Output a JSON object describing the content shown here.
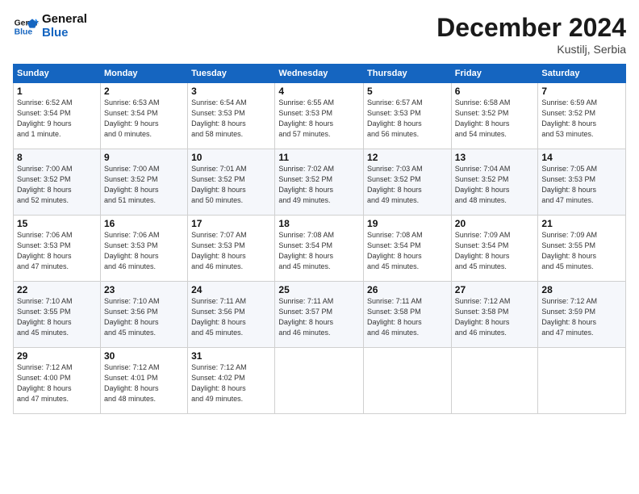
{
  "logo": {
    "line1": "General",
    "line2": "Blue"
  },
  "title": "December 2024",
  "subtitle": "Kustilj, Serbia",
  "header_days": [
    "Sunday",
    "Monday",
    "Tuesday",
    "Wednesday",
    "Thursday",
    "Friday",
    "Saturday"
  ],
  "weeks": [
    [
      {
        "day": "1",
        "info": "Sunrise: 6:52 AM\nSunset: 3:54 PM\nDaylight: 9 hours\nand 1 minute."
      },
      {
        "day": "2",
        "info": "Sunrise: 6:53 AM\nSunset: 3:54 PM\nDaylight: 9 hours\nand 0 minutes."
      },
      {
        "day": "3",
        "info": "Sunrise: 6:54 AM\nSunset: 3:53 PM\nDaylight: 8 hours\nand 58 minutes."
      },
      {
        "day": "4",
        "info": "Sunrise: 6:55 AM\nSunset: 3:53 PM\nDaylight: 8 hours\nand 57 minutes."
      },
      {
        "day": "5",
        "info": "Sunrise: 6:57 AM\nSunset: 3:53 PM\nDaylight: 8 hours\nand 56 minutes."
      },
      {
        "day": "6",
        "info": "Sunrise: 6:58 AM\nSunset: 3:52 PM\nDaylight: 8 hours\nand 54 minutes."
      },
      {
        "day": "7",
        "info": "Sunrise: 6:59 AM\nSunset: 3:52 PM\nDaylight: 8 hours\nand 53 minutes."
      }
    ],
    [
      {
        "day": "8",
        "info": "Sunrise: 7:00 AM\nSunset: 3:52 PM\nDaylight: 8 hours\nand 52 minutes."
      },
      {
        "day": "9",
        "info": "Sunrise: 7:00 AM\nSunset: 3:52 PM\nDaylight: 8 hours\nand 51 minutes."
      },
      {
        "day": "10",
        "info": "Sunrise: 7:01 AM\nSunset: 3:52 PM\nDaylight: 8 hours\nand 50 minutes."
      },
      {
        "day": "11",
        "info": "Sunrise: 7:02 AM\nSunset: 3:52 PM\nDaylight: 8 hours\nand 49 minutes."
      },
      {
        "day": "12",
        "info": "Sunrise: 7:03 AM\nSunset: 3:52 PM\nDaylight: 8 hours\nand 49 minutes."
      },
      {
        "day": "13",
        "info": "Sunrise: 7:04 AM\nSunset: 3:52 PM\nDaylight: 8 hours\nand 48 minutes."
      },
      {
        "day": "14",
        "info": "Sunrise: 7:05 AM\nSunset: 3:53 PM\nDaylight: 8 hours\nand 47 minutes."
      }
    ],
    [
      {
        "day": "15",
        "info": "Sunrise: 7:06 AM\nSunset: 3:53 PM\nDaylight: 8 hours\nand 47 minutes."
      },
      {
        "day": "16",
        "info": "Sunrise: 7:06 AM\nSunset: 3:53 PM\nDaylight: 8 hours\nand 46 minutes."
      },
      {
        "day": "17",
        "info": "Sunrise: 7:07 AM\nSunset: 3:53 PM\nDaylight: 8 hours\nand 46 minutes."
      },
      {
        "day": "18",
        "info": "Sunrise: 7:08 AM\nSunset: 3:54 PM\nDaylight: 8 hours\nand 45 minutes."
      },
      {
        "day": "19",
        "info": "Sunrise: 7:08 AM\nSunset: 3:54 PM\nDaylight: 8 hours\nand 45 minutes."
      },
      {
        "day": "20",
        "info": "Sunrise: 7:09 AM\nSunset: 3:54 PM\nDaylight: 8 hours\nand 45 minutes."
      },
      {
        "day": "21",
        "info": "Sunrise: 7:09 AM\nSunset: 3:55 PM\nDaylight: 8 hours\nand 45 minutes."
      }
    ],
    [
      {
        "day": "22",
        "info": "Sunrise: 7:10 AM\nSunset: 3:55 PM\nDaylight: 8 hours\nand 45 minutes."
      },
      {
        "day": "23",
        "info": "Sunrise: 7:10 AM\nSunset: 3:56 PM\nDaylight: 8 hours\nand 45 minutes."
      },
      {
        "day": "24",
        "info": "Sunrise: 7:11 AM\nSunset: 3:56 PM\nDaylight: 8 hours\nand 45 minutes."
      },
      {
        "day": "25",
        "info": "Sunrise: 7:11 AM\nSunset: 3:57 PM\nDaylight: 8 hours\nand 46 minutes."
      },
      {
        "day": "26",
        "info": "Sunrise: 7:11 AM\nSunset: 3:58 PM\nDaylight: 8 hours\nand 46 minutes."
      },
      {
        "day": "27",
        "info": "Sunrise: 7:12 AM\nSunset: 3:58 PM\nDaylight: 8 hours\nand 46 minutes."
      },
      {
        "day": "28",
        "info": "Sunrise: 7:12 AM\nSunset: 3:59 PM\nDaylight: 8 hours\nand 47 minutes."
      }
    ],
    [
      {
        "day": "29",
        "info": "Sunrise: 7:12 AM\nSunset: 4:00 PM\nDaylight: 8 hours\nand 47 minutes."
      },
      {
        "day": "30",
        "info": "Sunrise: 7:12 AM\nSunset: 4:01 PM\nDaylight: 8 hours\nand 48 minutes."
      },
      {
        "day": "31",
        "info": "Sunrise: 7:12 AM\nSunset: 4:02 PM\nDaylight: 8 hours\nand 49 minutes."
      },
      null,
      null,
      null,
      null
    ]
  ]
}
